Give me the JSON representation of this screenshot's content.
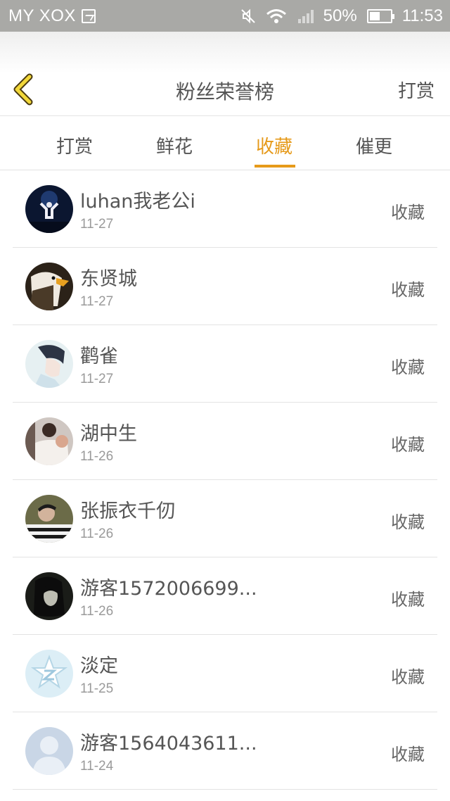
{
  "status_bar": {
    "carrier": "MY XOX",
    "battery": "50%",
    "battery_level": 0.5,
    "time": "11:53",
    "icons": [
      "image-icon",
      "mute-icon",
      "wifi-icon",
      "signal-icon",
      "battery-icon"
    ]
  },
  "header": {
    "back_icon": "chevron-left-icon",
    "title": "粉丝荣誉榜",
    "right_action": "打赏"
  },
  "tabs": [
    {
      "label": "打赏",
      "active": false
    },
    {
      "label": "鲜花",
      "active": false
    },
    {
      "label": "收藏",
      "active": true
    },
    {
      "label": "催更",
      "active": false
    }
  ],
  "accent_color": "#e69a1a",
  "list": [
    {
      "name": "luhan我老公i",
      "date": "11-27",
      "action": "收藏",
      "avatar": "avatar-concert"
    },
    {
      "name": "东贤城",
      "date": "11-27",
      "action": "收藏",
      "avatar": "avatar-eagle"
    },
    {
      "name": "鹳雀",
      "date": "11-27",
      "action": "收藏",
      "avatar": "avatar-boy"
    },
    {
      "name": "湖中生",
      "date": "11-26",
      "action": "收藏",
      "avatar": "avatar-baby"
    },
    {
      "name": "张振衣千仞",
      "date": "11-26",
      "action": "收藏",
      "avatar": "avatar-man"
    },
    {
      "name": "游客1572006699...",
      "date": "11-26",
      "action": "收藏",
      "avatar": "avatar-dark"
    },
    {
      "name": "淡定",
      "date": "11-25",
      "action": "收藏",
      "avatar": "avatar-qzone"
    },
    {
      "name": "游客1564043611...",
      "date": "11-24",
      "action": "收藏",
      "avatar": "avatar-default"
    }
  ]
}
